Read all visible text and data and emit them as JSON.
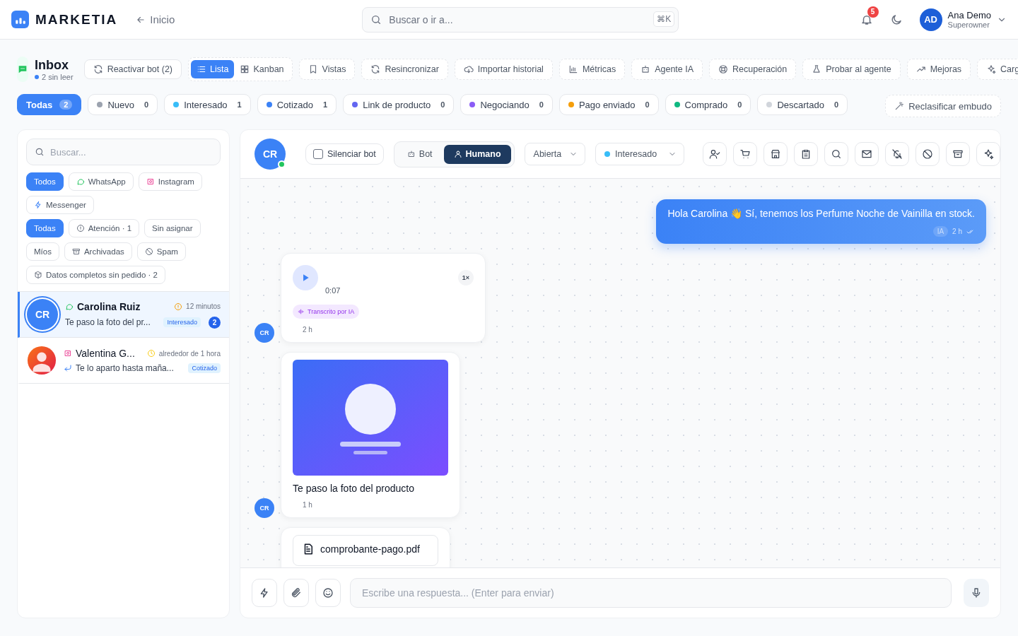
{
  "header": {
    "brand": "MARKETIA",
    "back_link": "Inicio",
    "search": {
      "placeholder": "Buscar o ir a...",
      "shortcut": "⌘K"
    },
    "notifications": "5",
    "user": {
      "initials": "AD",
      "name": "Ana Demo",
      "role": "Superowner"
    }
  },
  "inbox": {
    "title": "Inbox",
    "unread": "2 sin leer",
    "reactivate": "Reactivar bot (2)"
  },
  "view_toggle": [
    {
      "label": "Lista",
      "selected": true
    },
    {
      "label": "Kanban",
      "selected": false
    }
  ],
  "toolbar": [
    "Vistas",
    "Resincronizar",
    "Importar historial",
    "Métricas",
    "Agente IA",
    "Recuperación",
    "Probar al agente",
    "Mejoras",
    "Carg"
  ],
  "stages": [
    {
      "label": "Todas",
      "count": "2",
      "selected": true
    },
    {
      "label": "Nuevo",
      "count": "0",
      "color": "#9ca3af",
      "selected": false
    },
    {
      "label": "Interesado",
      "count": "1",
      "color": "#38bdf8",
      "selected": false
    },
    {
      "label": "Cotizado",
      "count": "1",
      "color": "#3b82f6",
      "selected": false
    },
    {
      "label": "Link de producto",
      "count": "0",
      "color": "#6366f1",
      "selected": false
    },
    {
      "label": "Negociando",
      "count": "0",
      "color": "#8b5cf6",
      "selected": false
    },
    {
      "label": "Pago enviado",
      "count": "0",
      "color": "#f59e0b",
      "selected": false
    },
    {
      "label": "Comprado",
      "count": "0",
      "color": "#10b981",
      "selected": false
    },
    {
      "label": "Descartado",
      "count": "0",
      "color": "#d1d5db",
      "selected": false
    }
  ],
  "reclassify": "Reclasificar embudo",
  "sidebar": {
    "search": {
      "placeholder": "Buscar..."
    },
    "channels": [
      {
        "label": "Todos",
        "selected": true
      },
      {
        "label": "WhatsApp",
        "selected": false
      },
      {
        "label": "Instagram",
        "selected": false
      },
      {
        "label": "Messenger",
        "selected": false
      }
    ],
    "filters": [
      {
        "label": "Todas",
        "selected": true
      },
      {
        "label": "Atención · 1",
        "selected": false
      },
      {
        "label": "Sin asignar",
        "selected": false
      },
      {
        "label": "Míos",
        "selected": false
      },
      {
        "label": "Archivadas",
        "selected": false
      },
      {
        "label": "Spam",
        "selected": false
      },
      {
        "label": "Datos completos sin pedido · 2",
        "selected": false
      }
    ],
    "conversations": [
      {
        "initials": "CR",
        "kind": "whatsapp",
        "name": "Carolina Ruiz",
        "time": "12 minutos",
        "preview": "Te paso la foto del pr...",
        "stage": "Interesado",
        "unread": "2",
        "replied": false,
        "selected": true
      },
      {
        "kind": "instagram",
        "name": "Valentina G...",
        "time": "alrededor de 1 hora",
        "preview": "Te lo aparto hasta maña...",
        "stage": "Cotizado",
        "replied": true,
        "selected": false
      }
    ]
  },
  "chat": {
    "contact_initials": "CR",
    "online": true,
    "mute_bot": {
      "label": "Silenciar bot",
      "checked": false
    },
    "mode": [
      {
        "label": "Bot",
        "selected": false
      },
      {
        "label": "Humano",
        "selected": true
      }
    ],
    "status": "Abierta",
    "stage": {
      "label": "Interesado",
      "color": "#38bdf8"
    },
    "messages": [
      {
        "kind": "text",
        "text": "Hola Carolina 👋 Sí, tenemos los Perfume Noche de Vainilla en stock.",
        "badge": "IA",
        "time": "2 h",
        "read": true
      },
      {
        "kind": "audio",
        "avatar": "CR",
        "duration": "0:07",
        "speed": "1×",
        "transcribed": "Transcrito por IA",
        "time": "2 h"
      },
      {
        "avatar": "CR",
        "caption": "Te paso la foto del producto",
        "time": "1 h"
      },
      {
        "kind": "file",
        "filename": "comprobante-pago.pdf"
      }
    ],
    "composer": {
      "placeholder": "Escribe una respuesta... (Enter para enviar)"
    }
  }
}
